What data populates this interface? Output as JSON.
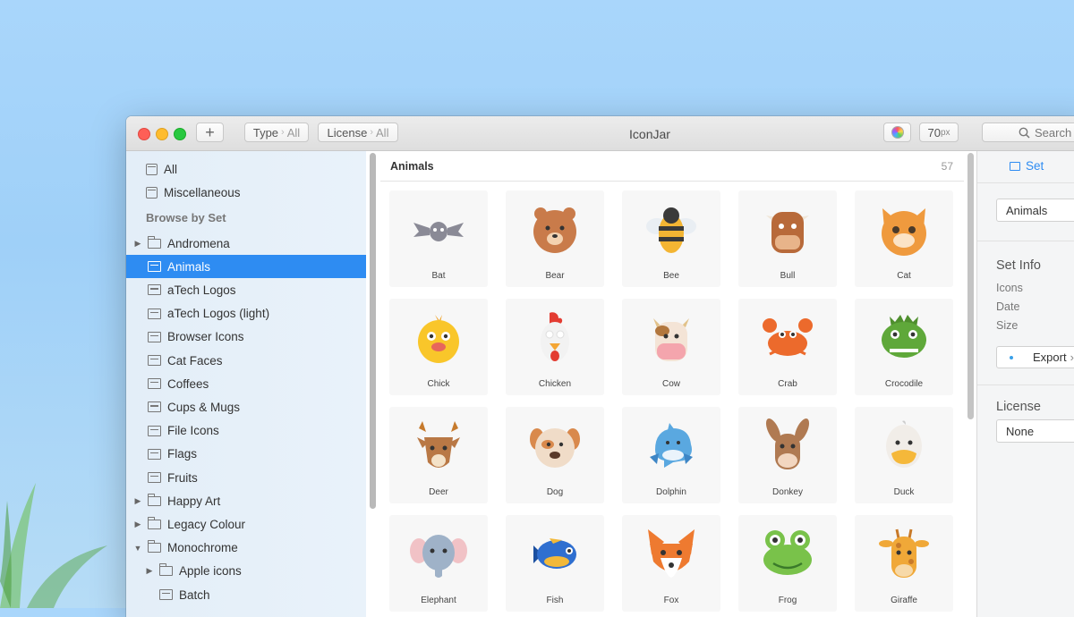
{
  "window": {
    "title": "IconJar",
    "toolbar": {
      "add_label": "+",
      "type_label": "Type",
      "type_value": "All",
      "license_label": "License",
      "license_value": "All",
      "size_value": "70",
      "size_unit": "px",
      "search_placeholder": "Search"
    }
  },
  "sidebar": {
    "top_items": [
      {
        "label": "All"
      },
      {
        "label": "Miscellaneous"
      }
    ],
    "section_header": "Browse by Set",
    "items": [
      {
        "label": "Andromena",
        "kind": "folder",
        "expanded": false
      },
      {
        "label": "Animals",
        "kind": "set",
        "selected": true
      },
      {
        "label": "aTech Logos",
        "kind": "set"
      },
      {
        "label": "aTech Logos (light)",
        "kind": "set"
      },
      {
        "label": "Browser Icons",
        "kind": "set"
      },
      {
        "label": "Cat Faces",
        "kind": "set"
      },
      {
        "label": "Coffees",
        "kind": "set"
      },
      {
        "label": "Cups & Mugs",
        "kind": "set"
      },
      {
        "label": "File Icons",
        "kind": "set"
      },
      {
        "label": "Flags",
        "kind": "set"
      },
      {
        "label": "Fruits",
        "kind": "set"
      },
      {
        "label": "Happy Art",
        "kind": "folder",
        "expanded": false
      },
      {
        "label": "Legacy Colour",
        "kind": "folder",
        "expanded": false
      },
      {
        "label": "Monochrome",
        "kind": "folder",
        "expanded": true
      },
      {
        "label": "Apple icons",
        "kind": "folder",
        "expanded": false,
        "indent": 1
      },
      {
        "label": "Batch",
        "kind": "set",
        "indent": 1
      }
    ]
  },
  "content": {
    "title": "Animals",
    "count": "57",
    "icons": [
      {
        "name": "Bat",
        "icon": "bat-icon",
        "color": "#8a8a96"
      },
      {
        "name": "Bear",
        "icon": "bear-icon",
        "color": "#c97b4a"
      },
      {
        "name": "Bee",
        "icon": "bee-icon",
        "color": "#f3b533"
      },
      {
        "name": "Bull",
        "icon": "bull-icon",
        "color": "#b86a3a"
      },
      {
        "name": "Cat",
        "icon": "cat-icon",
        "color": "#ef9a3e"
      },
      {
        "name": "Chick",
        "icon": "chick-icon",
        "color": "#f9c62a"
      },
      {
        "name": "Chicken",
        "icon": "chicken-icon",
        "color": "#f2f2f2"
      },
      {
        "name": "Cow",
        "icon": "cow-icon",
        "color": "#f4e4d6"
      },
      {
        "name": "Crab",
        "icon": "crab-icon",
        "color": "#ec6a2c"
      },
      {
        "name": "Crocodile",
        "icon": "crocodile-icon",
        "color": "#5fa83a"
      },
      {
        "name": "Deer",
        "icon": "deer-icon",
        "color": "#b97845"
      },
      {
        "name": "Dog",
        "icon": "dog-icon",
        "color": "#f0dcc8"
      },
      {
        "name": "Dolphin",
        "icon": "dolphin-icon",
        "color": "#5aa8e0"
      },
      {
        "name": "Donkey",
        "icon": "donkey-icon",
        "color": "#b07a52"
      },
      {
        "name": "Duck",
        "icon": "duck-icon",
        "color": "#f1ede8"
      },
      {
        "name": "Elephant",
        "icon": "elephant-icon",
        "color": "#9fb2c8"
      },
      {
        "name": "Fish",
        "icon": "fish-icon",
        "color": "#2f6fd0"
      },
      {
        "name": "Fox",
        "icon": "fox-icon",
        "color": "#ee7a30"
      },
      {
        "name": "Frog",
        "icon": "frog-icon",
        "color": "#79c24a"
      },
      {
        "name": "Giraffe",
        "icon": "giraffe-icon",
        "color": "#f0a838"
      }
    ]
  },
  "right_panel": {
    "tab_label": "Set",
    "set_name": "Animals",
    "info_title": "Set Info",
    "info_rows": [
      {
        "label": "Icons"
      },
      {
        "label": "Date"
      },
      {
        "label": "Size"
      }
    ],
    "export_label": "Export",
    "license_title": "License",
    "license_value": "None"
  }
}
